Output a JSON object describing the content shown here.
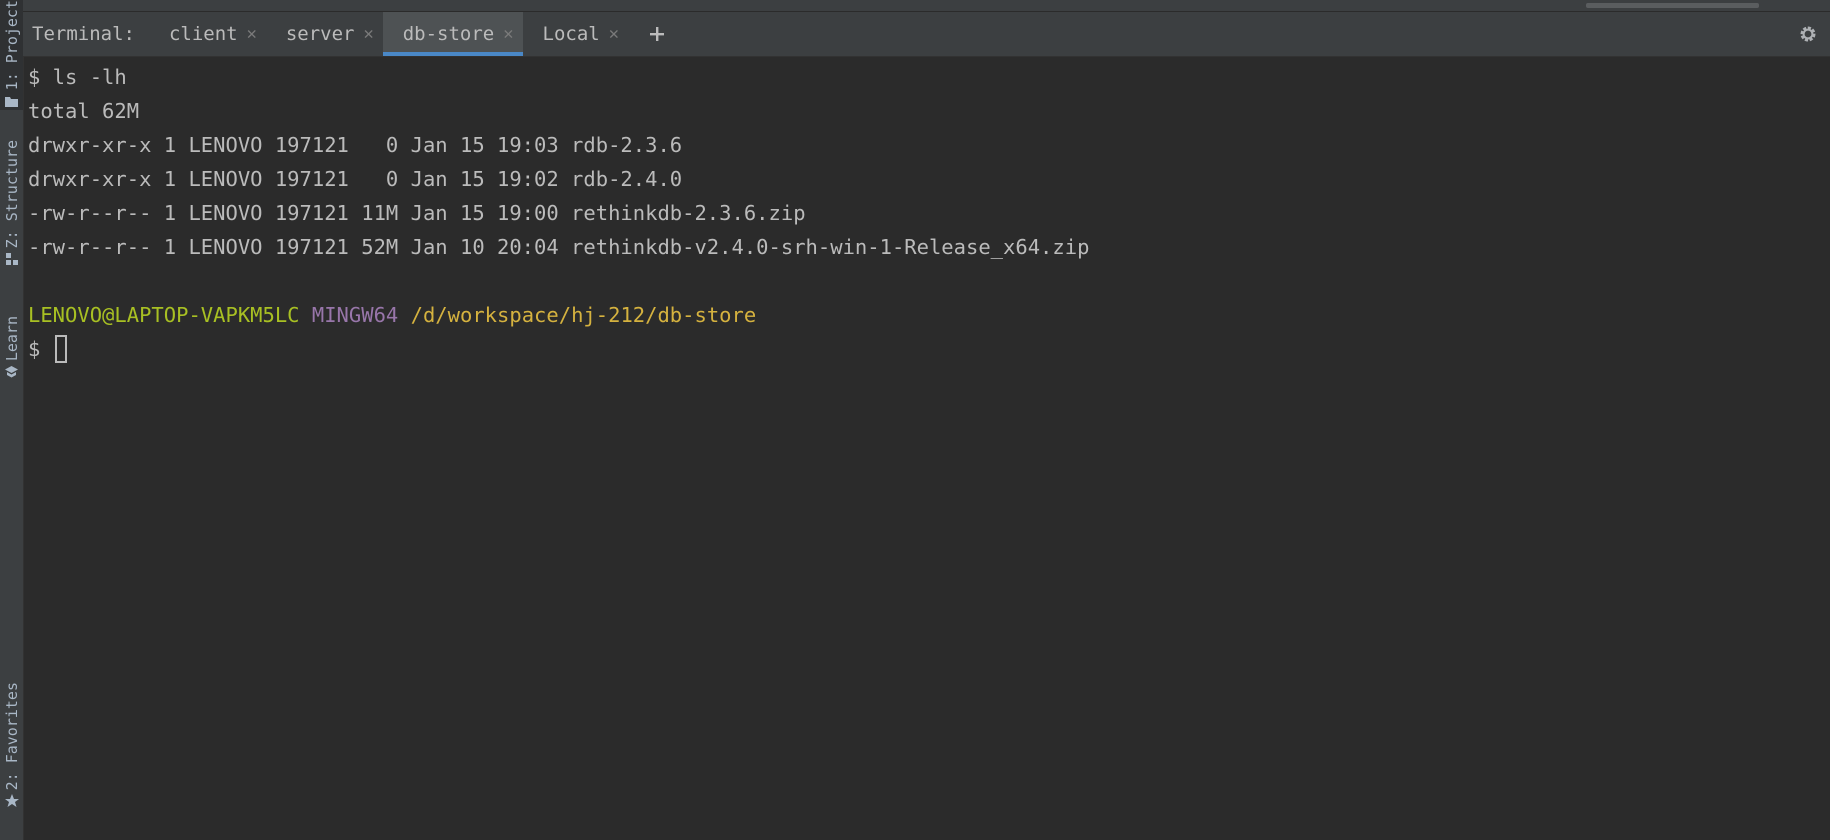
{
  "sidebar": {
    "project": "1: Project",
    "structure": "Z: Structure",
    "learn": "Learn",
    "favorites": "2: Favorites"
  },
  "terminal": {
    "title": "Terminal:",
    "tabs": [
      {
        "label": "client"
      },
      {
        "label": "server"
      },
      {
        "label": "db-store"
      },
      {
        "label": "Local"
      }
    ],
    "active_tab": "db-store",
    "lines": [
      "$ ls -lh",
      "total 62M",
      "drwxr-xr-x 1 LENOVO 197121   0 Jan 15 19:03 rdb-2.3.6",
      "drwxr-xr-x 1 LENOVO 197121   0 Jan 15 19:02 rdb-2.4.0",
      "-rw-r--r-- 1 LENOVO 197121 11M Jan 15 19:00 rethinkdb-2.3.6.zip",
      "-rw-r--r-- 1 LENOVO 197121 52M Jan 10 20:04 rethinkdb-v2.4.0-srh-win-1-Release_x64.zip",
      ""
    ],
    "prompt": {
      "user": "LENOVO@LAPTOP-VAPKM5LC",
      "system": "MINGW64",
      "path": "/d/workspace/hj-212/db-store",
      "symbol": "$ "
    }
  },
  "colors": {
    "background": "#2b2b2b",
    "text": "#bbbbbb",
    "user": "#a8c023",
    "system": "#9876aa",
    "path": "#d5b23f",
    "active_tab_underline": "#4a88c7"
  }
}
